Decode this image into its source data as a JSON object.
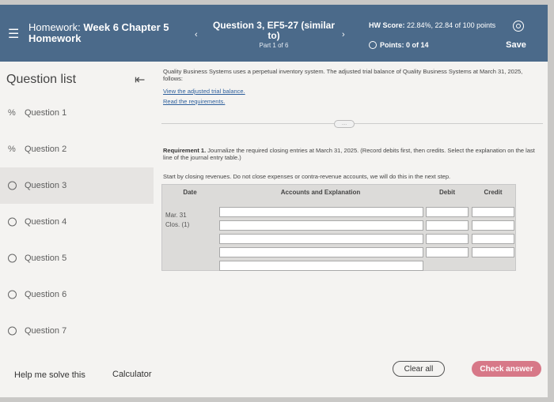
{
  "header": {
    "hw_title_bold": "Week 6 Chapter 5",
    "hw_title_prefix": "Homework:",
    "hw_title_line2": "Homework",
    "question_title": "Question 3, EF5-27 (similar to)",
    "part": "Part 1 of 6",
    "hw_score_label": "HW Score:",
    "hw_score_value": "22.84%, 22.84 of 100 points",
    "points": "Points: 0 of 14",
    "save_label": "Save"
  },
  "sidebar": {
    "title": "Question list",
    "items": [
      {
        "label": "Question 1",
        "status": "partial"
      },
      {
        "label": "Question 2",
        "status": "partial"
      },
      {
        "label": "Question 3",
        "status": "current"
      },
      {
        "label": "Question 4",
        "status": "unanswered"
      },
      {
        "label": "Question 5",
        "status": "unanswered"
      },
      {
        "label": "Question 6",
        "status": "unanswered"
      },
      {
        "label": "Question 7",
        "status": "unanswered"
      }
    ],
    "help_label": "Help me solve this",
    "calculator_label": "Calculator"
  },
  "main": {
    "intro": "Quality Business Systems uses a perpetual inventory system. The adjusted trial balance of Quality Business Systems at March 31, 2025, follows:",
    "link_trial_balance": "View the adjusted trial balance.",
    "link_requirements": "Read the requirements.",
    "more_dots": "....",
    "requirement_label": "Requirement 1.",
    "requirement_text": "Journalize the required closing entries at March 31, 2025. (Record debits first, then credits. Select the explanation on the last line of the journal entry table.)",
    "start_text": "Start by closing revenues. Do not close expenses or contra-revenue accounts, we will do this in the next step.",
    "table": {
      "headers": [
        "Date",
        "Accounts and Explanation",
        "Debit",
        "Credit"
      ],
      "date_line1": "Mar. 31",
      "date_line2": "Clos. (1)"
    }
  },
  "footer": {
    "clear_label": "Clear all",
    "check_label": "Check answer"
  },
  "colors": {
    "header_bg": "#4b6a8a",
    "check_button": "#d77888"
  }
}
